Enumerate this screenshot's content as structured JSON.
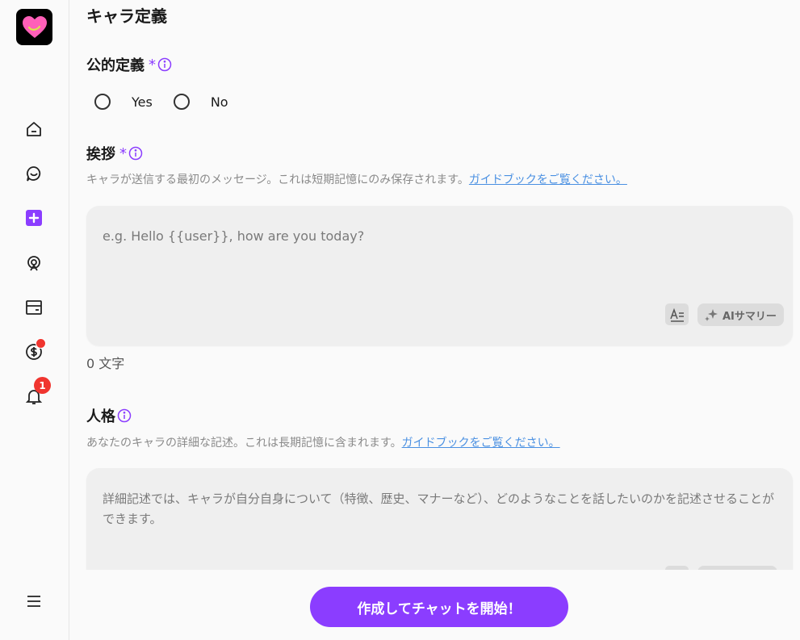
{
  "sidebar": {
    "logo_icon": "heart-logo-icon",
    "items": [
      {
        "name": "home-icon"
      },
      {
        "name": "chat-icon"
      },
      {
        "name": "create-icon",
        "active": true
      },
      {
        "name": "character-icon"
      },
      {
        "name": "wallet-icon"
      },
      {
        "name": "coin-icon",
        "badge_dot": true
      },
      {
        "name": "bell-icon",
        "badge": "1"
      }
    ],
    "menu_icon": "menu-icon"
  },
  "main": {
    "section_title": "キャラ定義",
    "public_definition": {
      "label": "公的定義",
      "required": "*",
      "options": [
        "Yes",
        "No"
      ]
    },
    "greeting": {
      "label": "挨拶",
      "required": "*",
      "description": "キャラが送信する最初のメッセージ。これは短期記憶にのみ保存されます。",
      "guide_link": "ガイドブックをご覧ください。",
      "placeholder": "e.g. Hello {{user}}, how are you today?",
      "ai_button": "AIサマリー",
      "count": "0 文字"
    },
    "personality": {
      "label": "人格",
      "description": "あなたのキャラの詳細な記述。これは長期記憶に含まれます。",
      "guide_link": "ガイドブックをご覧ください。",
      "placeholder": "詳細記述では、キャラが自分自身について（特徴、歴史、マナーなど）、どのようなことを話したいのかを記述させることができます。"
    },
    "cta": "作成してチャットを開始！"
  },
  "colors": {
    "accent": "#8b3dff",
    "link": "#4a90e2",
    "badge": "#f0352f"
  }
}
